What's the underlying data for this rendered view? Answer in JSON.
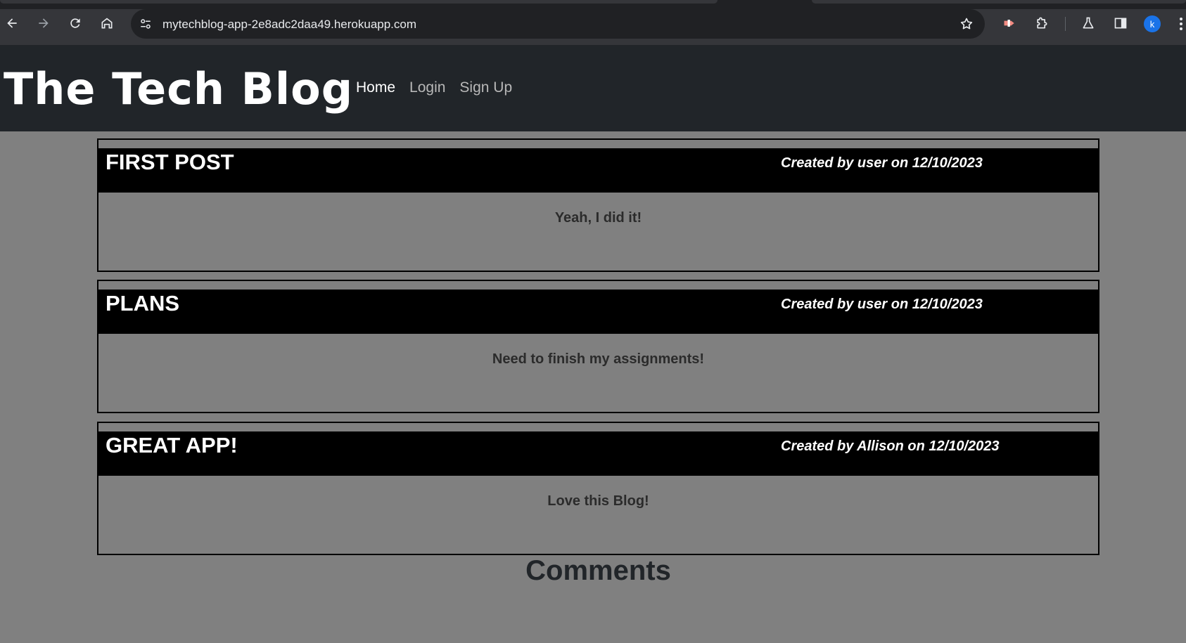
{
  "browser": {
    "url": "mytechblog-app-2e8adc2daa49.herokuapp.com",
    "profile_initial": "k"
  },
  "site": {
    "title": "The Tech Blog",
    "nav": [
      {
        "label": "Home",
        "active": true
      },
      {
        "label": "Login",
        "active": false
      },
      {
        "label": "Sign Up",
        "active": false
      }
    ]
  },
  "posts": [
    {
      "title": "FIRST POST",
      "meta": "Created by user on 12/10/2023",
      "body": "Yeah, I did it!"
    },
    {
      "title": "PLANS",
      "meta": "Created by user on 12/10/2023",
      "body": "Need to finish my assignments!"
    },
    {
      "title": "GREAT APP!",
      "meta": "Created by Allison on 12/10/2023",
      "body": "Love this Blog!"
    }
  ],
  "comments": {
    "heading": "Comments"
  },
  "colors": {
    "header_bg": "#212529",
    "page_bg": "#808080",
    "post_bar_bg": "#000000"
  }
}
